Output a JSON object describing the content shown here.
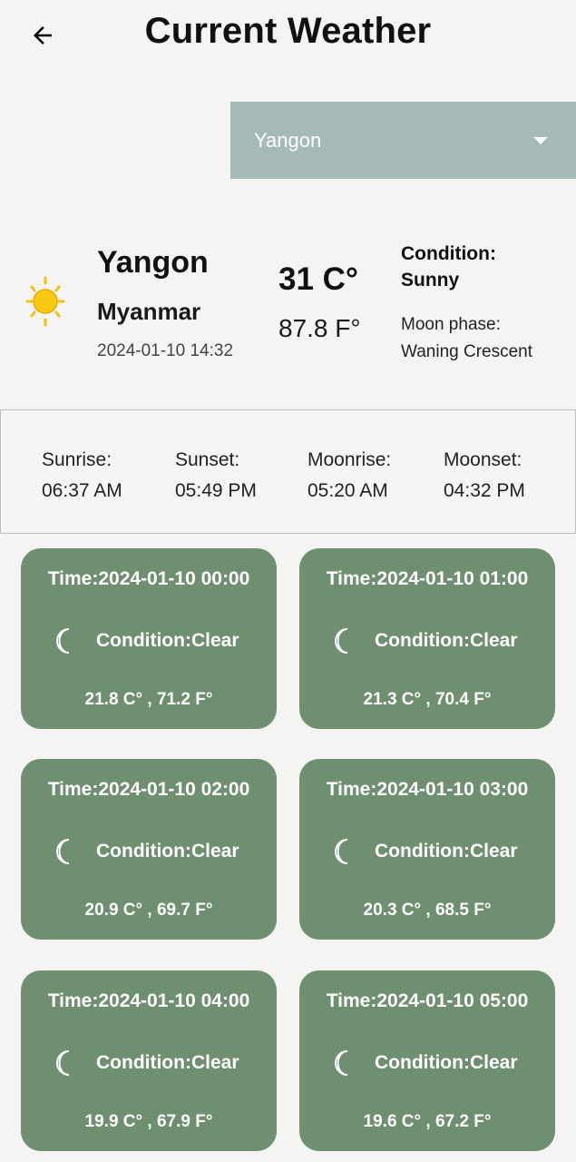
{
  "header": {
    "title": "Current Weather",
    "back_icon": "arrow-left-icon"
  },
  "city_select": {
    "selected": "Yangon"
  },
  "current": {
    "city": "Yangon",
    "country": "Myanmar",
    "local_time": "2024-01-10 14:32",
    "temp_c": "31 C°",
    "temp_f": "87.8 F°",
    "condition_label": "Condition:",
    "condition": "Sunny",
    "moon_label": "Moon phase:",
    "moon_phase": "Waning Crescent",
    "icon": "sun-icon"
  },
  "astro": [
    {
      "label": "Sunrise:",
      "value": "06:37 AM"
    },
    {
      "label": "Sunset:",
      "value": "05:49 PM"
    },
    {
      "label": "Moonrise:",
      "value": "05:20 AM"
    },
    {
      "label": "Moonset:",
      "value": "04:32 PM"
    }
  ],
  "hourly": [
    {
      "time": "Time:2024-01-10 00:00",
      "condition": "Condition:Clear",
      "temps": "21.8 C° , 71.2 F°",
      "icon": "moon-icon"
    },
    {
      "time": "Time:2024-01-10 01:00",
      "condition": "Condition:Clear",
      "temps": "21.3 C° , 70.4 F°",
      "icon": "moon-icon"
    },
    {
      "time": "Time:2024-01-10 02:00",
      "condition": "Condition:Clear",
      "temps": "20.9 C° , 69.7 F°",
      "icon": "moon-icon"
    },
    {
      "time": "Time:2024-01-10 03:00",
      "condition": "Condition:Clear",
      "temps": "20.3 C° , 68.5 F°",
      "icon": "moon-icon"
    },
    {
      "time": "Time:2024-01-10 04:00",
      "condition": "Condition:Clear",
      "temps": "19.9 C° , 67.9 F°",
      "icon": "moon-icon"
    },
    {
      "time": "Time:2024-01-10 05:00",
      "condition": "Condition:Clear",
      "temps": "19.6 C° , 67.2 F°",
      "icon": "moon-icon"
    }
  ],
  "colors": {
    "card_bg": "#6f9070",
    "dropdown_bg": "#a5b9b6",
    "sun": "#f4c20d",
    "moon": "#1565c0"
  }
}
